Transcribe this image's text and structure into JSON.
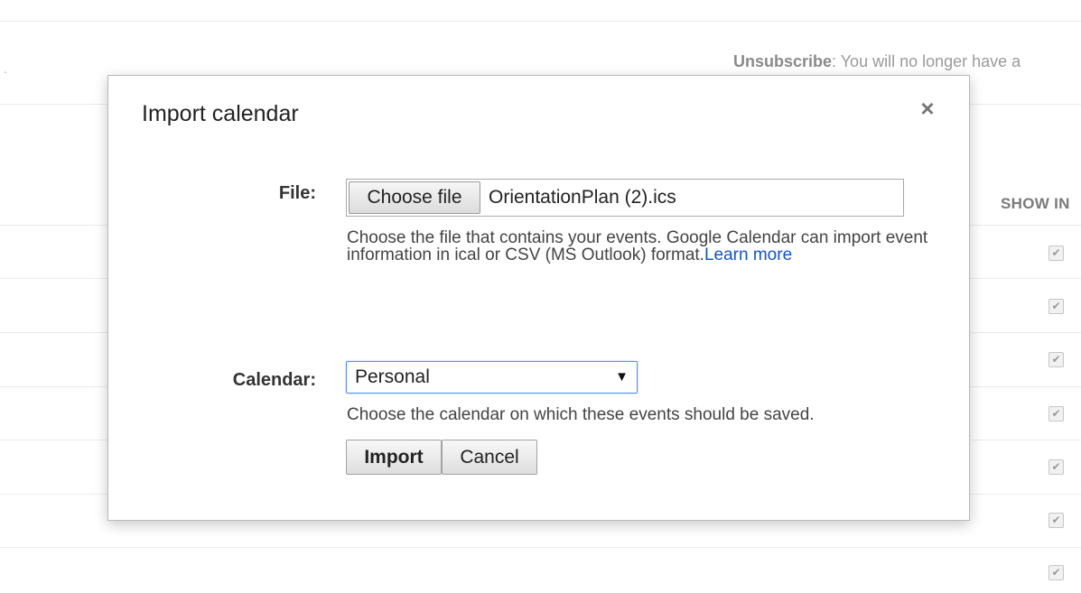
{
  "background": {
    "unsubscribe_label": "Unsubscribe",
    "unsubscribe_text": ": You will no longer have a",
    "show_in_header": "SHOW IN",
    "checkbox_glyph": "✔",
    "stray_mark": "."
  },
  "dialog": {
    "title": "Import calendar",
    "close_glyph": "×",
    "file": {
      "label": "File:",
      "choose_button": "Choose file",
      "file_name": "OrientationPlan (2).ics",
      "help_text": "Choose the file that contains your events. Google Calendar can import event information in ical or CSV (MS Outlook) format.",
      "learn_more": "Learn more"
    },
    "calendar": {
      "label": "Calendar:",
      "selected": "Personal",
      "arrow_glyph": "▼",
      "help_text": "Choose the calendar on which these events should be saved."
    },
    "buttons": {
      "import": "Import",
      "cancel": "Cancel"
    }
  },
  "icons": {
    "close": "close-icon",
    "dropdown": "chevron-down-icon",
    "checkbox": "check-icon"
  },
  "colors": {
    "link": "#1155cc",
    "focus_border": "#4d90fe"
  }
}
